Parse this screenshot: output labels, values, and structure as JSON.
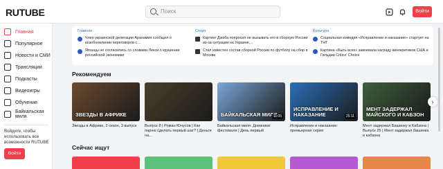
{
  "app": {
    "logo": "RUTUBE",
    "accent": "#ef3f4a"
  },
  "search": {
    "placeholder": "Поиск"
  },
  "header": {
    "login_label": "Войти",
    "icons": [
      "upload-icon",
      "bell-icon"
    ]
  },
  "sidebar": {
    "items": [
      {
        "label": "Главная",
        "icon": "home-icon",
        "active": true
      },
      {
        "label": "Популярное",
        "icon": "popular-icon"
      },
      {
        "label": "Новости и СМИ",
        "icon": "news-icon"
      },
      {
        "label": "Трансляции",
        "icon": "broadcast-icon"
      },
      {
        "label": "Подкасты",
        "icon": "podcast-icon"
      },
      {
        "label": "Видеоигры",
        "icon": "gamepad-icon"
      },
      {
        "label": "Обучение",
        "icon": "education-icon"
      },
      {
        "label": "Байкальская миля",
        "icon": "flag-icon"
      }
    ],
    "invite_text": "Войдите, чтобы использовать все возможности RUTUBE",
    "login_label": "Войти"
  },
  "news": [
    {
      "category": "Главное",
      "items": [
        "Член украинской делегации Арахамия сообщил о возобновлении переговоров с...",
        "Японцы не согласились со словами Лекси о крушении российской экономики"
      ]
    },
    {
      "category": "Спорт",
      "items": [
        "Картинг Дзюба попросил не вызывать его в сборную России из-за ситуации на Украине,...",
        "Стал известен состав сборной России по футболу на сбор в Москве"
      ]
    },
    {
      "category": "Культура",
      "items": [
        "Социальная комедия «Исправление и наказание» стартует на ТНТ",
        "Картина «Быть всех» завоевала награду кинокритиков США и Гильдии Critics' Choice"
      ]
    }
  ],
  "recommended": {
    "title": "Рекомендуем",
    "cards": [
      {
        "thumb_text": "ЗВЕЗДЫ В АФРИКЕ",
        "title": "Звезды в Африке, 2 сезон, 3 выпуск",
        "duration": "",
        "bg": "#6b4a2f"
      },
      {
        "thumb_text": "",
        "title": "Выпуск 8 | Роман Юнусов | Как парню сделать первый шаг? | Деньги на...",
        "duration": "",
        "bg": "#4a3f2a"
      },
      {
        "thumb_text": "БАЙКАЛЬСКАЯ МИЛЯ",
        "title": "Байкальская миля. Дневники фестиваля | День первый",
        "duration": "11:05",
        "bg": "#7aa7d9"
      },
      {
        "thumb_text": "ИСПРАВЛЕНИЕ И НАКАЗАНИЕ",
        "title": "Исправление и наказание: премьерная серия",
        "duration": "25:11",
        "bg": "#2a6fb8"
      },
      {
        "thumb_text": "МЕНТ ЗАДЕРЖАЛ МАЙСКОГО И КАБЗОН",
        "title": "Мент задержал Башинку и Кабзона | Выпуск 25 | Мент задержал башинка и кабзона",
        "duration": "",
        "bg": "#3d5e3a"
      }
    ]
  },
  "now_searching": {
    "title": "Сейчас ищут",
    "tiles": [
      "#ef3f4a",
      "#5ac27a",
      "#f0c93a",
      "#b65ad4",
      "#e8864a"
    ]
  }
}
